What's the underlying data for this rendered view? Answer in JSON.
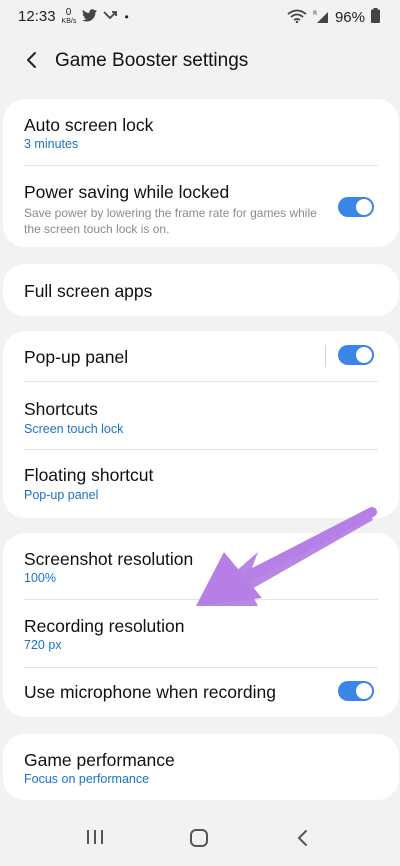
{
  "status_bar": {
    "time": "12:33",
    "data_rate_value": "0",
    "data_rate_unit": "KB/s",
    "extra_dot": "•",
    "battery": "96%"
  },
  "header": {
    "title": "Game Booster settings"
  },
  "card1": {
    "auto_lock_title": "Auto screen lock",
    "auto_lock_value": "3 minutes",
    "power_saving_title": "Power saving while locked",
    "power_saving_desc": "Save power by lowering the frame rate for games while the screen touch lock is on.",
    "power_saving_on": true
  },
  "card2": {
    "full_screen_title": "Full screen apps"
  },
  "card3": {
    "popup_title": "Pop-up panel",
    "popup_on": true,
    "shortcuts_title": "Shortcuts",
    "shortcuts_value": "Screen touch lock",
    "floating_title": "Floating shortcut",
    "floating_value": "Pop-up panel"
  },
  "card4": {
    "screenshot_title": "Screenshot resolution",
    "screenshot_value": "100%",
    "recording_title": "Recording resolution",
    "recording_value": "720 px",
    "microphone_title": "Use microphone when recording",
    "microphone_on": true
  },
  "card5": {
    "performance_title": "Game performance",
    "performance_value": "Focus on performance"
  },
  "colors": {
    "accent": "#3a86e6",
    "link": "#1a73c9",
    "annotation_arrow": "#b57fe6"
  },
  "icons": {
    "back": "back-arrow-icon",
    "recents": "recents-icon",
    "home": "home-icon",
    "nav_back": "nav-back-icon"
  }
}
